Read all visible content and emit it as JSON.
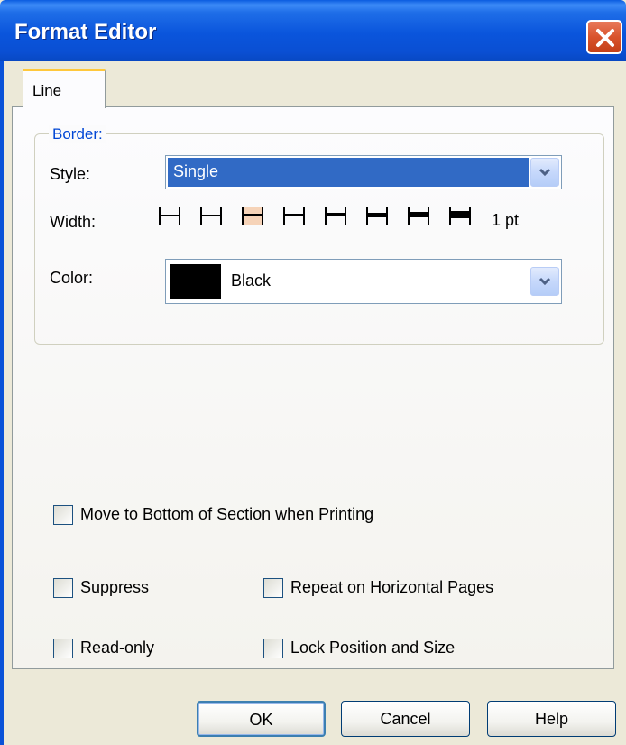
{
  "window": {
    "title": "Format Editor",
    "title_bar_color": "#0a55dc",
    "close_icon": "close-x-icon"
  },
  "tabs": [
    {
      "label": "Line",
      "active": true
    }
  ],
  "border_group": {
    "legend": "Border:",
    "style": {
      "label": "Style:",
      "value": "Single",
      "dropdown_icon": "chevron-down-icon"
    },
    "width": {
      "label": "Width:",
      "options_count": 8,
      "selected_index": 2,
      "value": "1 pt"
    },
    "color": {
      "label": "Color:",
      "swatch": "#000000",
      "value": "Black",
      "dropdown_icon": "chevron-down-icon"
    }
  },
  "checkboxes": {
    "move_to_bottom": {
      "label": "Move to Bottom of Section when Printing",
      "checked": false
    },
    "suppress": {
      "label": "Suppress",
      "checked": false
    },
    "repeat_on_horizontal": {
      "label": "Repeat on Horizontal Pages",
      "checked": false
    },
    "read_only": {
      "label": "Read-only",
      "checked": false
    },
    "lock_position": {
      "label": "Lock Position and Size",
      "checked": false
    }
  },
  "buttons": {
    "ok": "OK",
    "cancel": "Cancel",
    "help": "Help"
  },
  "colors": {
    "accent": "#316ac5",
    "legend_text": "#0046d5",
    "dialog_bg": "#ece9d8"
  }
}
